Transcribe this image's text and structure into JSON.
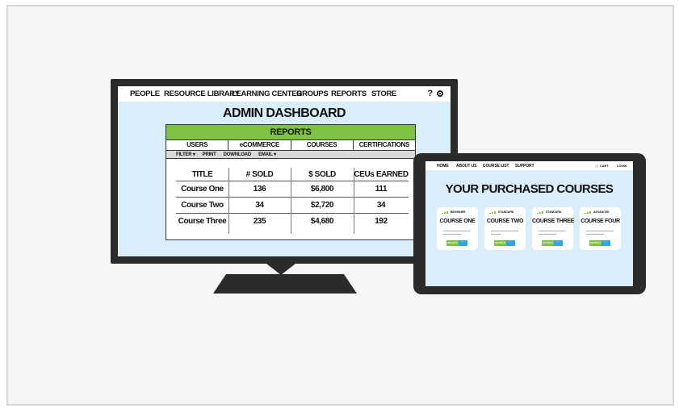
{
  "desktop": {
    "nav": [
      "PEOPLE",
      "RESOURCE LIBRARY",
      "LEARNING CENTER",
      "GROUPS",
      "REPORTS",
      "STORE"
    ],
    "help_icon": "?",
    "settings_icon": "⚙",
    "title": "ADMIN DASHBOARD",
    "reports_panel": {
      "header": "REPORTS",
      "tabs": [
        "USERS",
        "eCOMMERCE",
        "COURSES",
        "CERTIFICATIONS"
      ],
      "toolbar": [
        "FILTER ▾",
        "PRINT",
        "DOWNLOAD",
        "EMAIL ▾"
      ],
      "columns": [
        "TITLE",
        "# SOLD",
        "$ SOLD",
        "CEUs EARNED"
      ],
      "rows": [
        [
          "Course One",
          "136",
          "$6,800",
          "111"
        ],
        [
          "Course Two",
          "34",
          "$2,720",
          "34"
        ],
        [
          "Course Three",
          "235",
          "$4,680",
          "192"
        ]
      ]
    },
    "colors": {
      "header_green": "#7dc243",
      "screen_blue": "#d9eefa",
      "bezel": "#2b2b2b"
    }
  },
  "tablet": {
    "nav": [
      "HOME",
      "ABOUT US",
      "COURSE LIST",
      "SUPPORT"
    ],
    "cart": "🛒 CART",
    "login": "LOGIN",
    "title": "YOUR PURCHASED COURSES",
    "courses": [
      {
        "level": "BEGINNER",
        "name": "COURSE ONE",
        "details": "DETAILS"
      },
      {
        "level": "STANDARD",
        "name": "COURSE TWO",
        "details": "DETAILS"
      },
      {
        "level": "STANDARD",
        "name": "COURSE THREE",
        "details": "DETAILS"
      },
      {
        "level": "ADVANCED",
        "name": "COURSE FOUR",
        "details": "DETAILS"
      }
    ],
    "colors": {
      "details_green": "#7dc243",
      "cart_blue": "#2aa7e0"
    }
  }
}
